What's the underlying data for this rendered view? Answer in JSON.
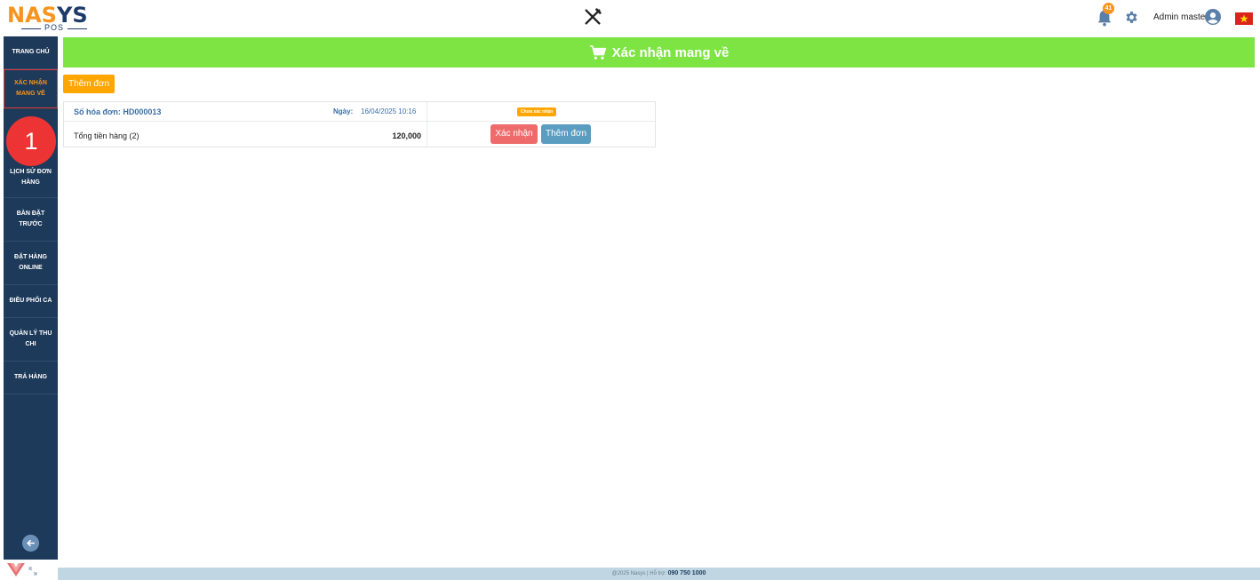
{
  "header": {
    "logo_na": "NA",
    "logo_s": "S",
    "logo_ys": "YS",
    "logo_pos": "POS",
    "notification_count": "41",
    "user_name": "Admin master"
  },
  "sidebar": {
    "items": [
      {
        "label": "TRANG CHỦ"
      },
      {
        "label": "XÁC NHẬN MANG VỀ"
      },
      {
        "label": "LỊCH SỬ ĐƠN HÀNG"
      },
      {
        "label": "BÀN ĐẶT TRƯỚC"
      },
      {
        "label": "ĐẶT HÀNG ONLINE"
      },
      {
        "label": "ĐIỀU PHỐI CA"
      },
      {
        "label": "QUẢN LÝ THU CHI"
      },
      {
        "label": "TRẢ HÀNG"
      }
    ]
  },
  "step_badge": "1",
  "main": {
    "title": "Xác nhận mang về",
    "add_order_label": "Thêm đơn",
    "order": {
      "id_label": "Số hóa đơn: HD000013",
      "date_label": "Ngày:",
      "date": "16/04/2025 10:16",
      "status": "Chưa xác nhận",
      "total_label": "Tổng tiền hàng (2)",
      "total": "120,000",
      "confirm_label": "Xác nhận",
      "add_label": "Thêm đơn"
    }
  },
  "footer": {
    "copyright": "@2025 Nasys | Hỗ trợ:",
    "phone": "090 750 1000"
  },
  "colors": {
    "sidebar_bg": "#1e3a5a",
    "title_bar": "#7de444",
    "accent_orange": "#ffa600",
    "confirm_red": "#ef6a6a",
    "add_blue": "#5a9dc0",
    "badge_red": "#ed3434"
  },
  "icons": [
    "utensils-icon",
    "bell-icon",
    "gear-icon",
    "user-avatar-icon",
    "vietnam-flag-icon",
    "cart-icon",
    "back-arrow-icon",
    "expand-icon"
  ]
}
